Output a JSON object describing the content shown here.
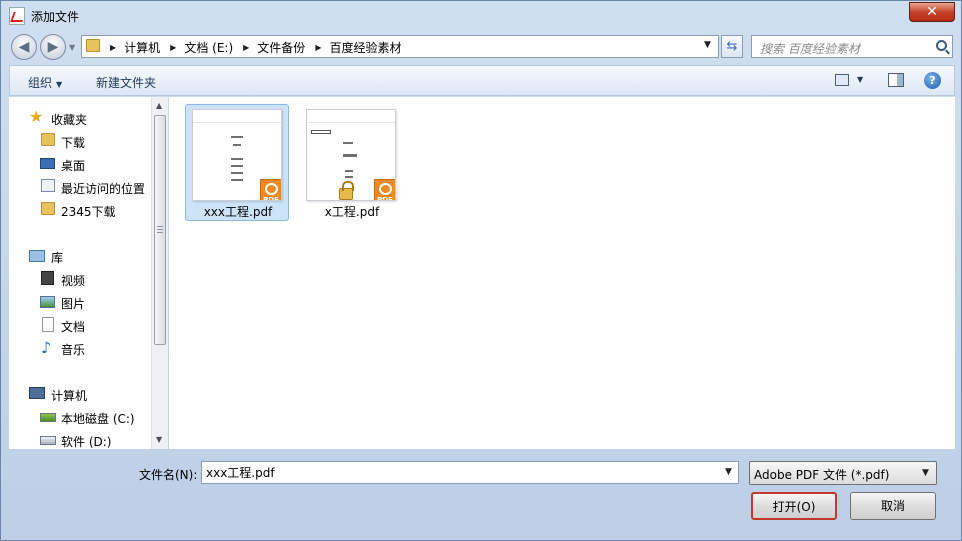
{
  "window": {
    "title": "添加文件"
  },
  "toolbar": {
    "close_glyph": "✕"
  },
  "address": {
    "breadcrumbs": [
      "计算机",
      "文档 (E:)",
      "文件备份",
      "百度经验素材"
    ]
  },
  "search": {
    "placeholder": "搜索 百度经验素材"
  },
  "commands": {
    "organize": "组织",
    "new_folder": "新建文件夹",
    "help": "?"
  },
  "nav": {
    "items": [
      {
        "label": "收藏夹",
        "icon": "star-icon"
      },
      {
        "label": "下载",
        "icon": "folder-icon"
      },
      {
        "label": "桌面",
        "icon": "desktop-icon"
      },
      {
        "label": "最近访问的位置",
        "icon": "recent-places-icon"
      },
      {
        "label": "2345下载",
        "icon": "folder-icon"
      },
      {
        "label": "库",
        "icon": "library-icon"
      },
      {
        "label": "视频",
        "icon": "video-icon"
      },
      {
        "label": "图片",
        "icon": "picture-icon"
      },
      {
        "label": "文档",
        "icon": "document-icon"
      },
      {
        "label": "音乐",
        "icon": "music-icon"
      },
      {
        "label": "计算机",
        "icon": "computer-icon"
      },
      {
        "label": "本地磁盘 (C:)",
        "icon": "drive-icon"
      },
      {
        "label": "软件 (D:)",
        "icon": "drive-icon"
      }
    ]
  },
  "files": [
    {
      "name": "xxx工程.pdf",
      "selected": true,
      "locked": false
    },
    {
      "name": "x工程.pdf",
      "selected": false,
      "locked": true
    }
  ],
  "bottom": {
    "filename_label": "文件名(N):",
    "filename_value": "xxx工程.pdf",
    "filetype_value": "Adobe PDF 文件 (*.pdf)",
    "open_label": "打开(O)",
    "cancel_label": "取消"
  }
}
